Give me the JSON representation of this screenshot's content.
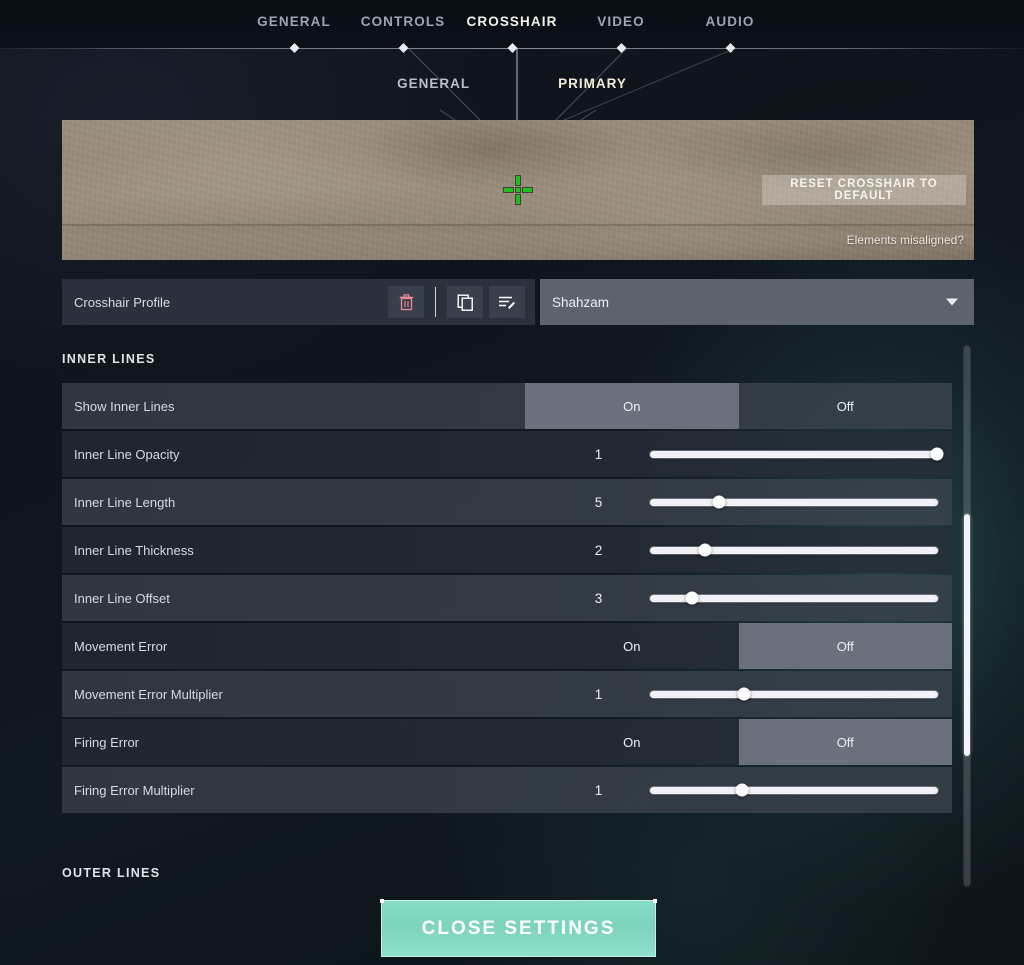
{
  "nav": {
    "items": [
      {
        "label": "GENERAL",
        "active": false
      },
      {
        "label": "CONTROLS",
        "active": false
      },
      {
        "label": "CROSSHAIR",
        "active": true
      },
      {
        "label": "VIDEO",
        "active": false
      },
      {
        "label": "AUDIO",
        "active": false
      }
    ]
  },
  "subnav": {
    "items": [
      {
        "label": "GENERAL",
        "active": false
      },
      {
        "label": "PRIMARY",
        "active": true
      }
    ]
  },
  "preview": {
    "reset_label": "RESET CROSSHAIR TO DEFAULT",
    "misaligned_label": "Elements misaligned?",
    "crosshair_color": "#20c020"
  },
  "profile": {
    "label": "Crosshair Profile",
    "selected": "Shahzam",
    "icons": [
      {
        "name": "delete-icon",
        "color": "#e88b96"
      },
      {
        "name": "duplicate-icon",
        "color": "#ffffff"
      },
      {
        "name": "rename-icon",
        "color": "#ffffff"
      }
    ]
  },
  "sections": {
    "inner_lines_title": "INNER LINES",
    "outer_lines_title": "OUTER LINES"
  },
  "toggle_labels": {
    "on": "On",
    "off": "Off"
  },
  "rows": [
    {
      "label": "Show Inner Lines",
      "type": "toggle",
      "selected": "on",
      "shade": "light"
    },
    {
      "label": "Inner Line Opacity",
      "type": "slider",
      "value": "1",
      "pct": 99.5,
      "shade": "dark"
    },
    {
      "label": "Inner Line Length",
      "type": "slider",
      "value": "5",
      "pct": 24,
      "shade": "light"
    },
    {
      "label": "Inner Line Thickness",
      "type": "slider",
      "value": "2",
      "pct": 19,
      "shade": "dark"
    },
    {
      "label": "Inner Line Offset",
      "type": "slider",
      "value": "3",
      "pct": 14.5,
      "shade": "light"
    },
    {
      "label": "Movement Error",
      "type": "toggle",
      "selected": "off",
      "shade": "dark"
    },
    {
      "label": "Movement Error Multiplier",
      "type": "slider",
      "value": "1",
      "pct": 32.5,
      "shade": "light"
    },
    {
      "label": "Firing Error",
      "type": "toggle",
      "selected": "off",
      "shade": "dark"
    },
    {
      "label": "Firing Error Multiplier",
      "type": "slider",
      "value": "1",
      "pct": 32,
      "shade": "light"
    }
  ],
  "footer": {
    "close_label": "CLOSE SETTINGS",
    "close_color": "#7ed3bd"
  }
}
